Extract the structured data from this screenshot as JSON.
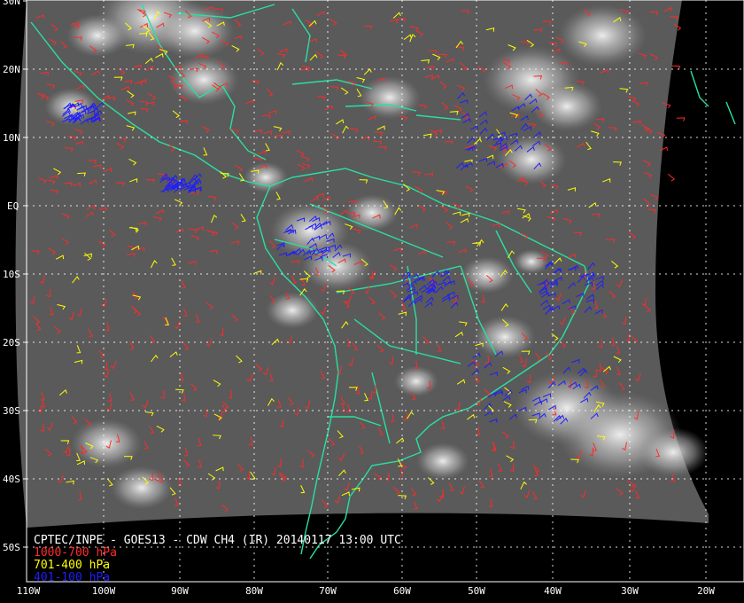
{
  "title": "CPTEC/INPE - GOES13 - CDW CH4 (IR) 20140117 13:00 UTC",
  "legend": [
    {
      "label": "1000-700 hPa",
      "color": "#ff2a2a"
    },
    {
      "label": "701-400 hPa",
      "color": "#ffff00"
    },
    {
      "label": "401-100 hPa",
      "color": "#1e1eff"
    }
  ],
  "latitude_labels": [
    "30N",
    "20N",
    "10N",
    "EQ",
    "10S",
    "20S",
    "30S",
    "40S",
    "50S"
  ],
  "longitude_labels": [
    "110W",
    "100W",
    "90W",
    "80W",
    "70W",
    "60W",
    "50W",
    "40W",
    "30W",
    "20W"
  ],
  "colors": {
    "coastline": "#29e0a0",
    "gridline": "#ffffff",
    "background": "#000000"
  }
}
